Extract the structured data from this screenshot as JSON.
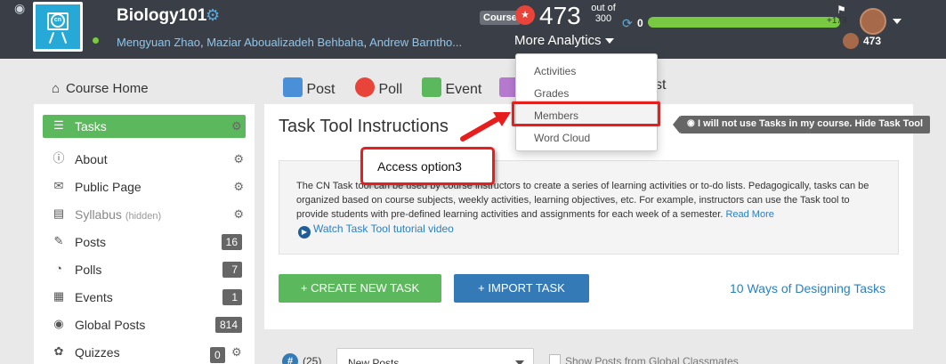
{
  "header": {
    "course_name": "Biology101",
    "instructors": [
      "Mengyuan Zhao",
      "Maziar Aboualizadeh Behbaha",
      "Andrew Barntho..."
    ],
    "course_badge": "Course",
    "score": "473",
    "out_of_label": "out of",
    "out_of_value": "300",
    "more_analytics": "More Analytics",
    "progress_value": "0",
    "progress_increment": "+173",
    "user_score": "473"
  },
  "analytics_menu": {
    "items": [
      "Activities",
      "Grades",
      "Members",
      "Word Cloud"
    ],
    "highlighted": "Members"
  },
  "annotation": {
    "callout": "Access option3"
  },
  "left_nav": {
    "course_home": "Course Home",
    "items": [
      {
        "label": "Tasks",
        "icon": "list-icon",
        "active": true
      },
      {
        "label": "About",
        "icon": "info-icon",
        "gear": true
      },
      {
        "label": "Public Page",
        "icon": "megaphone-icon",
        "gear": true
      },
      {
        "label": "Syllabus",
        "hidden_tag": "(hidden)",
        "icon": "syllabus-icon",
        "gear": true
      },
      {
        "label": "Posts",
        "icon": "post-icon",
        "count": "16"
      },
      {
        "label": "Polls",
        "icon": "poll-icon",
        "count": "7"
      },
      {
        "label": "Events",
        "icon": "calendar-icon",
        "count": "1"
      },
      {
        "label": "Global Posts",
        "icon": "globe-icon",
        "count": "814"
      },
      {
        "label": "Quizzes",
        "icon": "brain-icon",
        "count": "0",
        "gear": true
      }
    ]
  },
  "toolbar": {
    "post": "Post",
    "poll": "Poll",
    "event": "Event",
    "list_partial": "st"
  },
  "task_card": {
    "title": "Task Tool Instructions",
    "hide_label": "I will not use Tasks in my course. Hide Task Tool",
    "description": "The CN Task tool can be used by course instructors to create a series of learning activities or to-do lists. Pedagogically, tasks can be organized based on course subjects, weekly activities, learning objectives, etc. For example, instructors can use the Task tool to provide students with pre-defined learning activities and assignments for each week of a semester.",
    "read_more": "Read More",
    "video_link": "Watch Task Tool tutorial video",
    "create_button": "+ CREATE NEW TASK",
    "import_button": "+ IMPORT TASK",
    "ten_ways_link": "10 Ways of Designing Tasks"
  },
  "filters": {
    "hash_count": "(25)",
    "post_filter": "New Posts",
    "global_label": "Show Posts from Global Classmates"
  },
  "colors": {
    "header_bg": "#3a3f47",
    "accent_green": "#5cb85c",
    "accent_blue": "#337ab7",
    "link_blue": "#2a7fc1",
    "annotation_red": "#e61e1e"
  }
}
